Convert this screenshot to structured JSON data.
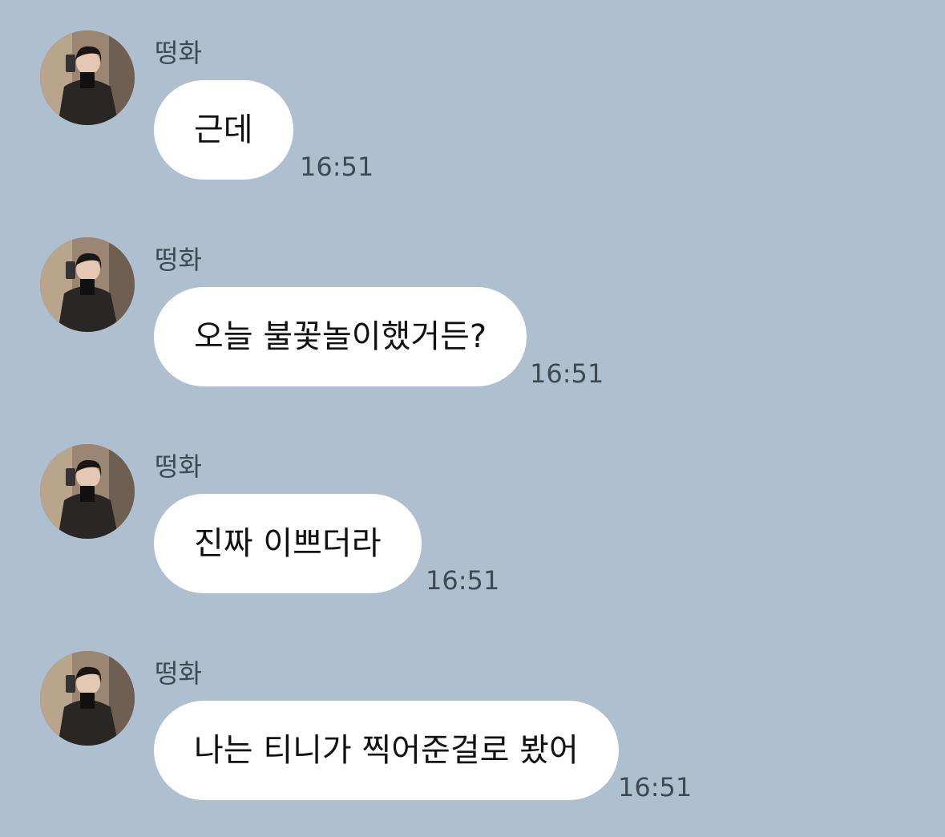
{
  "theme": {
    "background": "#aec0cf",
    "bubble_color": "#ffffff",
    "text_color": "#111111",
    "sender_color": "#3d4a56",
    "time_color": "#3d4a56"
  },
  "messages": [
    {
      "sender": "떵화",
      "avatar": "profile-photo-avatar",
      "text": "근데",
      "time": "16:51"
    },
    {
      "sender": "떵화",
      "avatar": "profile-photo-avatar",
      "text": "오늘 불꽃놀이했거든?",
      "time": "16:51"
    },
    {
      "sender": "떵화",
      "avatar": "profile-photo-avatar",
      "text": "진짜 이쁘더라",
      "time": "16:51"
    },
    {
      "sender": "떵화",
      "avatar": "profile-photo-avatar",
      "text": "나는 티니가 찍어준걸로 봤어",
      "time": "16:51"
    }
  ]
}
